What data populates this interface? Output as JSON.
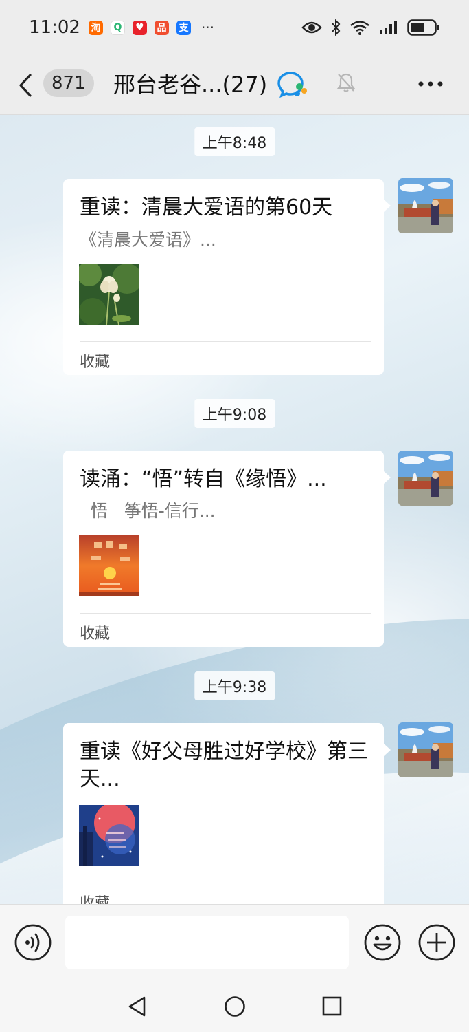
{
  "status_bar": {
    "time": "11:02",
    "app_icons": [
      {
        "glyph": "淘",
        "color": "#ff6a00"
      },
      {
        "glyph": "Q",
        "color": "#ffffff"
      },
      {
        "glyph": "♥",
        "color": "#e8232c"
      },
      {
        "glyph": "品",
        "color": "#f04e2f"
      },
      {
        "glyph": "支",
        "color": "#1677ff"
      }
    ],
    "more_icons": "···"
  },
  "header": {
    "back_count": "871",
    "title": "邢台老谷...(27)",
    "icons": [
      "back-arrow-icon",
      "group-chat-icon",
      "mute-bell-icon",
      "more-icon"
    ]
  },
  "messages": [
    {
      "time": "上午8:48",
      "title": "重读：清晨大爱语的第60天",
      "subtitle": "《清晨大爱语》...",
      "source": "收藏",
      "thumb": "lotus"
    },
    {
      "time": "上午9:08",
      "title": "读涌：“悟”转自《缘悟》...",
      "subtitle": "  悟   筝悟-信行...",
      "source": "收藏",
      "thumb": "poem"
    },
    {
      "time": "上午9:38",
      "title": "重读《好父母胜过好学校》第三天...",
      "subtitle": "",
      "source": "收藏",
      "thumb": "night"
    }
  ],
  "input_bar": {
    "placeholder": "",
    "icons": [
      "voice-icon",
      "emoji-icon",
      "plus-icon"
    ]
  },
  "nav_bar": {
    "icons": [
      "nav-back-icon",
      "nav-home-icon",
      "nav-recent-icon"
    ]
  },
  "colors": {
    "header_bg": "#ededed",
    "card_bg": "#ffffff",
    "chat_icon_blue": "#1a8fe6",
    "chat_icon_green": "#2bb673",
    "chat_icon_orange": "#f6a623"
  }
}
